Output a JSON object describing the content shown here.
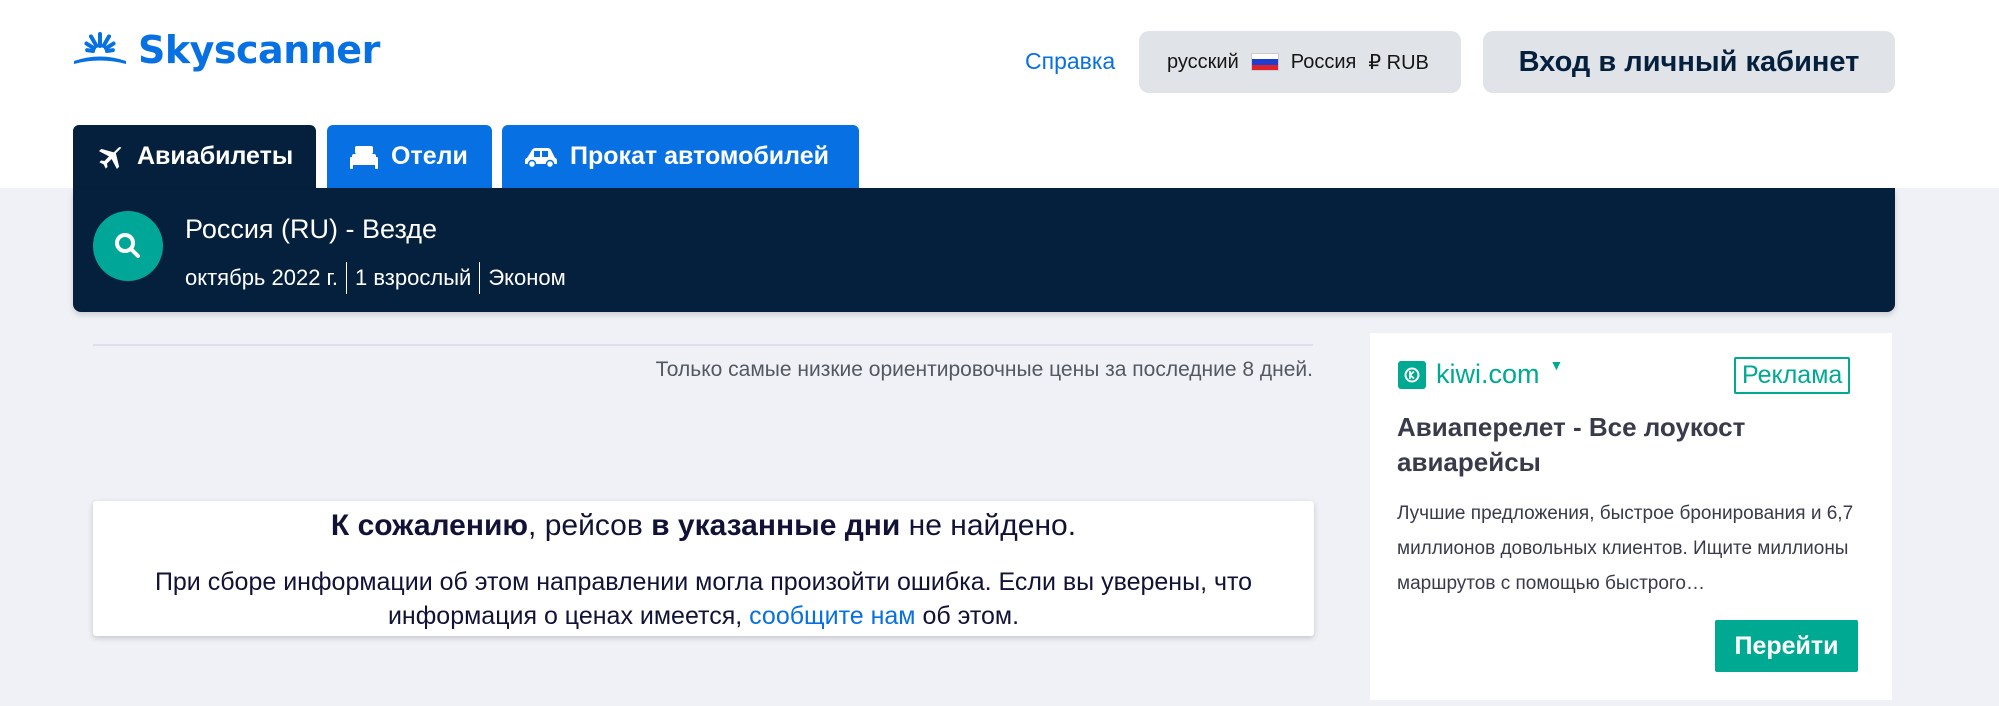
{
  "header": {
    "logo_text": "Skyscanner",
    "help_label": "Справка",
    "locale": {
      "language": "русский",
      "country": "Россия",
      "currency": "₽ RUB"
    },
    "login_label": "Вход в личный кабинет"
  },
  "tabs": [
    {
      "label": "Авиабилеты",
      "icon": "plane-icon",
      "active": true
    },
    {
      "label": "Отели",
      "icon": "bed-icon",
      "active": false
    },
    {
      "label": "Прокат автомобилей",
      "icon": "car-icon",
      "active": false
    }
  ],
  "search": {
    "route": "Россия (RU) - Везде",
    "date": "октябрь 2022 г.",
    "travellers": "1 взрослый",
    "cabin": "Эконом"
  },
  "results": {
    "disclaimer": "Только самые низкие ориентировочные цены за последние 8 дней.",
    "no_results": {
      "title_bold_1": "К сожалению",
      "title_part_1": ", рейсов ",
      "title_bold_2": "в указанные дни",
      "title_part_2": " не найдено.",
      "body_before": "При сборе информации об этом направлении могла произойти ошибка. Если вы уверены, что информация о ценах имеется, ",
      "link_text": "сообщите нам",
      "body_after": " об этом."
    }
  },
  "ad": {
    "brand": "kiwi.com",
    "badge": "Реклама",
    "title": "Авиаперелет - Все лоукост авиарейсы",
    "description": "Лучшие предложения, быстрое бронирования и 6,7 миллионов довольных клиентов. Ищите миллионы маршрутов с помощью быстрого…",
    "button_label": "Перейти"
  },
  "colors": {
    "brand_blue": "#0770e3",
    "navy": "#05203c",
    "teal": "#00a698",
    "kiwi_green": "#00a991",
    "page_bg": "#eff1f7"
  }
}
